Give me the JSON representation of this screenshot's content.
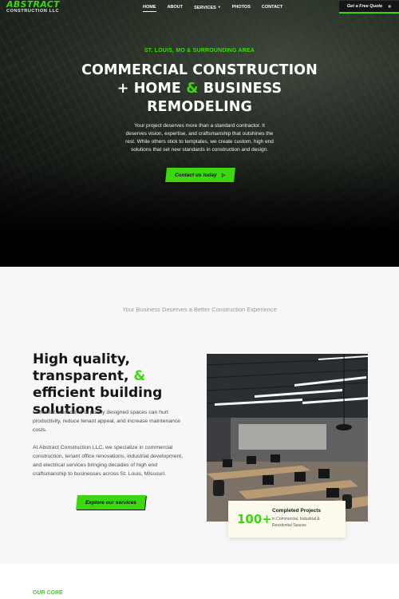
{
  "brand": {
    "name": "ABSTRACT",
    "subtitle": "CONSTRUCTION LLC",
    "accent": "#3cd70f"
  },
  "nav": {
    "items": [
      {
        "label": "HOME",
        "active": true
      },
      {
        "label": "ABOUT"
      },
      {
        "label": "SERVICES",
        "has_dropdown": true
      },
      {
        "label": "PHOTOS"
      },
      {
        "label": "CONTACT"
      }
    ],
    "cta": {
      "label": "Get a Free Quote",
      "icon": "double-chevron-right-icon"
    }
  },
  "hero": {
    "kicker": "ST. LOUIS, MO & SURROUNDING AREA",
    "title_line1": "COMMERCIAL CONSTRUCTION",
    "title_line2_a": "+ HOME ",
    "title_line2_amp": "&",
    "title_line2_b": " BUSINESS",
    "title_line3": "REMODELING",
    "description": "Your project deserves more than a standard contractor. It deserves vision, expertise, and craftsmanship that outshines the rest. While others stick to templates, we create custom, high end solutions that set new standards in construction and design.",
    "cta": {
      "label": "Contact us today",
      "icon": "arrow-right-icon"
    }
  },
  "intro": {
    "tagline": "Your Business Deserves a Better Construction Experience",
    "headline_a": "High quality, transparent, ",
    "headline_amp": "&",
    "headline_b": " efficient building solutions",
    "paragraph1": "Outdated, inefficient, or poorly designed spaces can hurt productivity, reduce tenant appeal, and increase maintenance costs.",
    "paragraph2": "At Abstract Construction LLC, we specialize in commercial construction, tenant office renovations, industrial development, and electrical services bringing decades of high end craftsmanship to businesses across St. Louis, Missouri.",
    "cta": {
      "label": "Explore our services"
    },
    "stat": {
      "number": "100+",
      "title": "Completed Projects",
      "description": "in Commercial, Industrial & Residential Spaces"
    }
  },
  "core": {
    "label": "OUR CORE"
  }
}
